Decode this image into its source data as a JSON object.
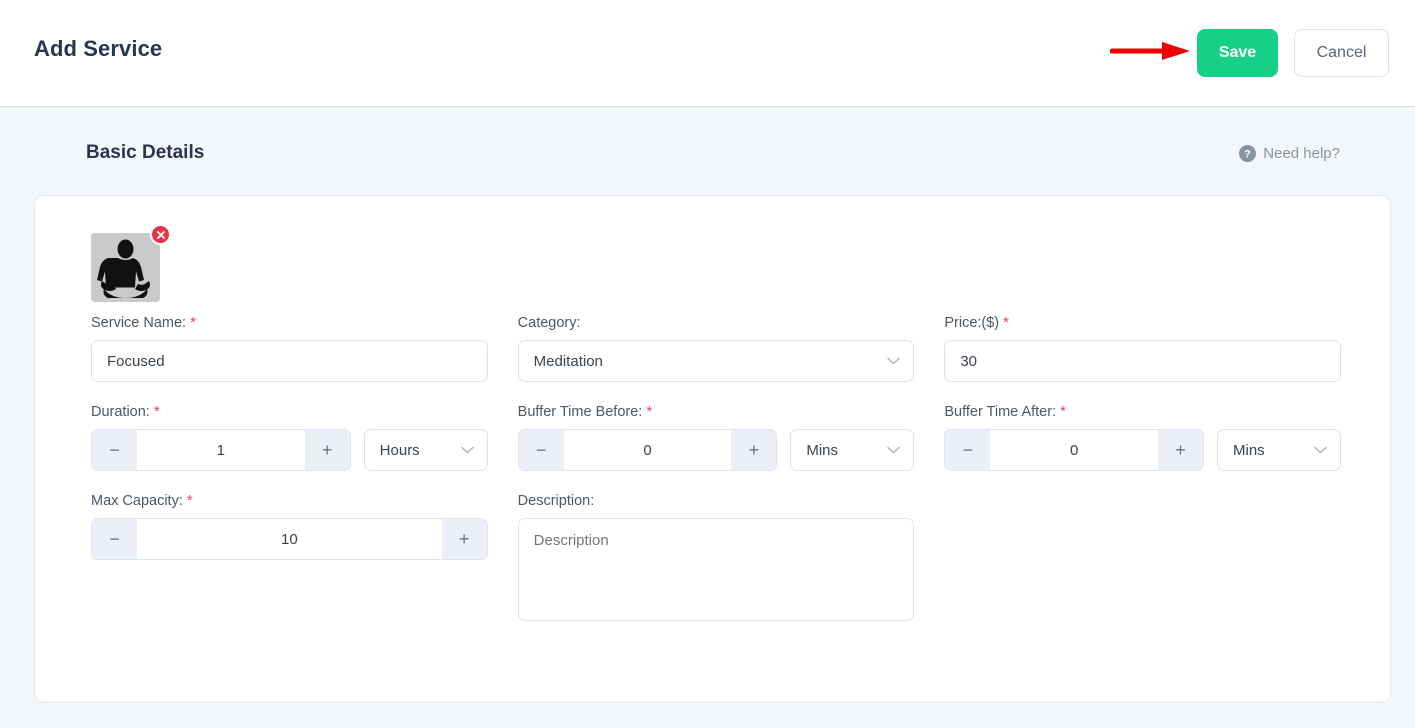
{
  "header": {
    "title": "Add Service",
    "save_label": "Save",
    "cancel_label": "Cancel",
    "annotation_arrow_color": "#ee0000",
    "save_color": "#17d088"
  },
  "section": {
    "title": "Basic Details",
    "need_help_label": "Need help?",
    "help_icon": "question-circle-icon"
  },
  "thumbnail": {
    "alt": "meditation-pose-image",
    "remove_icon": "close-x-icon"
  },
  "fields": {
    "service_name": {
      "label": "Service Name:",
      "required": "*",
      "value": "Focused"
    },
    "category": {
      "label": "Category:",
      "required": "",
      "value": "Meditation",
      "chevron_icon": "chevron-down-icon"
    },
    "price": {
      "label": "Price:($)",
      "required": "*",
      "value": "30"
    },
    "duration": {
      "label": "Duration:",
      "required": "*",
      "value": "1",
      "decrement": "−",
      "increment": "+",
      "unit": "Hours"
    },
    "buffer_before": {
      "label": "Buffer Time Before:",
      "required": "*",
      "value": "0",
      "decrement": "−",
      "increment": "+",
      "unit": "Mins"
    },
    "buffer_after": {
      "label": "Buffer Time After:",
      "required": "*",
      "value": "0",
      "decrement": "−",
      "increment": "+",
      "unit": "Mins"
    },
    "max_capacity": {
      "label": "Max Capacity:",
      "required": "*",
      "value": "10",
      "decrement": "−",
      "increment": "+"
    },
    "description": {
      "label": "Description:",
      "required": "",
      "placeholder": "Description",
      "value": ""
    }
  }
}
